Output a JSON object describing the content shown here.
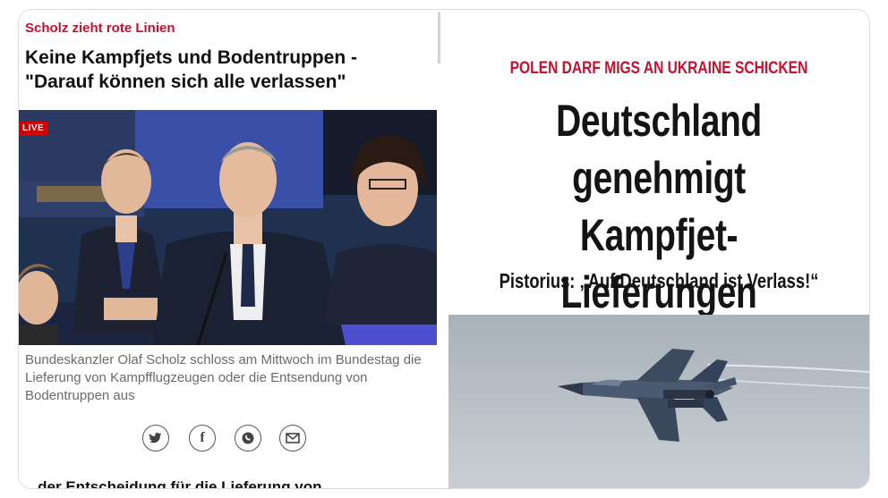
{
  "left_article": {
    "kicker": "Scholz zieht rote Linien",
    "headline_line1": "Keine Kampfjets und Bodentruppen -",
    "headline_line2": "\"Darauf können sich alle verlassen\"",
    "live_badge": "LIVE",
    "caption": "Bundeskanzler Olaf Scholz schloss am Mittwoch im Bundestag die Lieferung von Kampfflugzeugen oder die Entsendung von Bodentruppen aus",
    "share_icons": [
      "twitter-icon",
      "facebook-icon",
      "whatsapp-icon",
      "email-icon"
    ],
    "cut_off_text": "...der Entscheidung für die Lieferung von"
  },
  "right_article": {
    "kicker": "POLEN DARF MIGS AN UKRAINE SCHICKEN",
    "headline_line1": "Deutschland",
    "headline_line2": "genehmigt Kampfjet-",
    "headline_line3": "Lieferungen",
    "subline": "Pistorius: „Auf Deutschland ist Verlass!“"
  },
  "colors": {
    "accent_red": "#c8102e",
    "caption_gray": "#6b6b6b"
  }
}
